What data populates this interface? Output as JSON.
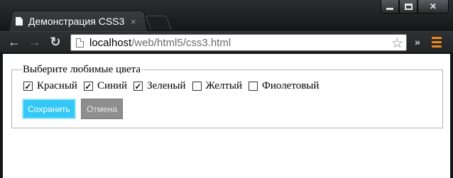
{
  "window": {
    "controls": {
      "minimize": "minimize",
      "maximize": "maximize",
      "close": "✕"
    }
  },
  "tab": {
    "title": "Демонстрация CSS3",
    "close": "×"
  },
  "toolbar": {
    "back": "←",
    "forward": "→",
    "reload": "↻",
    "url_host": "localhost",
    "url_path": "/web/html5/css3.html",
    "star": "☆",
    "overflow": "»"
  },
  "form": {
    "legend": "Выберите любимые цвета",
    "options": [
      {
        "label": "Красный",
        "checked": true
      },
      {
        "label": "Синий",
        "checked": true
      },
      {
        "label": "Зеленый",
        "checked": true
      },
      {
        "label": "Желтый",
        "checked": false
      },
      {
        "label": "Фиолетовый",
        "checked": false
      }
    ],
    "save_label": "Сохранить",
    "cancel_label": "Отмена"
  },
  "colors": {
    "save_button": "#33c8f5",
    "cancel_button": "#8e8e8e",
    "menu_icon": "#f08a1c"
  }
}
